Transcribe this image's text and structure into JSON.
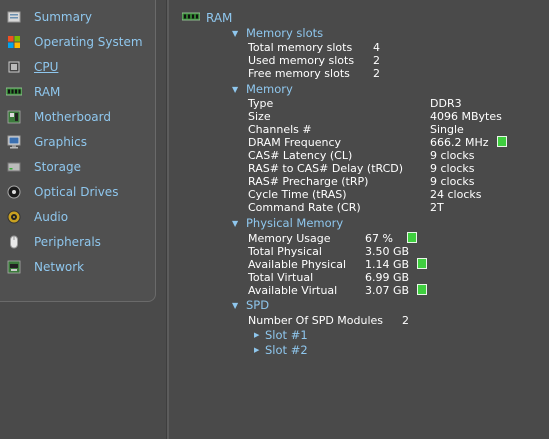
{
  "sidebar": {
    "items": [
      {
        "label": "Summary",
        "icon": "summary-icon"
      },
      {
        "label": "Operating System",
        "icon": "windows-icon"
      },
      {
        "label": "CPU",
        "icon": "cpu-icon"
      },
      {
        "label": "RAM",
        "icon": "ram-icon"
      },
      {
        "label": "Motherboard",
        "icon": "motherboard-icon"
      },
      {
        "label": "Graphics",
        "icon": "monitor-icon"
      },
      {
        "label": "Storage",
        "icon": "storage-icon"
      },
      {
        "label": "Optical Drives",
        "icon": "disc-icon"
      },
      {
        "label": "Audio",
        "icon": "speaker-icon"
      },
      {
        "label": "Peripherals",
        "icon": "mouse-icon"
      },
      {
        "label": "Network",
        "icon": "network-icon"
      }
    ]
  },
  "main": {
    "root_label": "RAM",
    "memory_slots": {
      "title": "Memory slots",
      "rows": [
        {
          "k": "Total memory slots",
          "v": "4"
        },
        {
          "k": "Used memory slots",
          "v": "2"
        },
        {
          "k": "Free memory slots",
          "v": "2"
        }
      ]
    },
    "memory": {
      "title": "Memory",
      "rows": [
        {
          "k": "Type",
          "v": "DDR3"
        },
        {
          "k": "Size",
          "v": "4096 MBytes"
        },
        {
          "k": "Channels #",
          "v": "Single"
        },
        {
          "k": "DRAM Frequency",
          "v": "666.2 MHz"
        },
        {
          "k": "CAS# Latency (CL)",
          "v": "9 clocks"
        },
        {
          "k": "RAS# to CAS# Delay (tRCD)",
          "v": "9 clocks"
        },
        {
          "k": "RAS# Precharge (tRP)",
          "v": "9 clocks"
        },
        {
          "k": "Cycle Time (tRAS)",
          "v": "24 clocks"
        },
        {
          "k": "Command Rate (CR)",
          "v": "2T"
        }
      ]
    },
    "physical_memory": {
      "title": "Physical Memory",
      "rows": [
        {
          "k": "Memory Usage",
          "v": "67 %"
        },
        {
          "k": "Total Physical",
          "v": "3.50 GB"
        },
        {
          "k": "Available Physical",
          "v": "1.14 GB"
        },
        {
          "k": "Total Virtual",
          "v": "6.99 GB"
        },
        {
          "k": "Available Virtual",
          "v": "3.07 GB"
        }
      ]
    },
    "spd": {
      "title": "SPD",
      "rows": [
        {
          "k": "Number Of SPD Modules",
          "v": "2"
        }
      ],
      "slots": [
        "Slot #1",
        "Slot #2"
      ]
    }
  },
  "colors": {
    "accent": "#8fc7ee",
    "background": "#4a4a4a",
    "indicator": "#3fcf3f"
  }
}
